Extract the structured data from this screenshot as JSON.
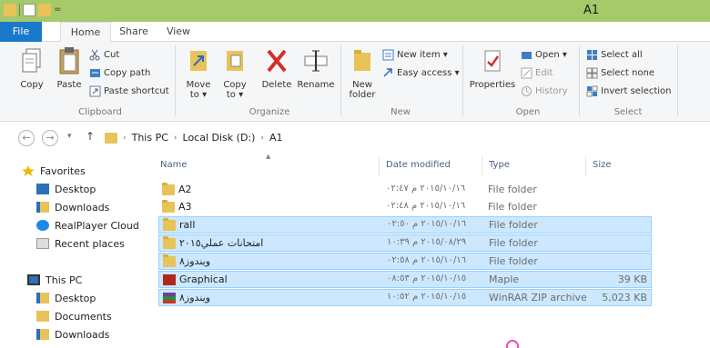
{
  "window": {
    "title": "A1"
  },
  "quick_access": {
    "arrow": "="
  },
  "tabs": {
    "file": "File",
    "home": "Home",
    "share": "Share",
    "view": "View"
  },
  "ribbon": {
    "clipboard": {
      "copy": "Copy",
      "paste": "Paste",
      "cut": "Cut",
      "copy_path": "Copy path",
      "paste_shortcut": "Paste shortcut",
      "group_label": "Clipboard"
    },
    "organize": {
      "move_to": "Move to ▾",
      "copy_to": "Copy to ▾",
      "delete": "Delete",
      "rename": "Rename",
      "group_label": "Organize"
    },
    "new": {
      "new_folder": "New folder",
      "new_item": "New item ▾",
      "easy_access": "Easy access ▾",
      "group_label": "New"
    },
    "open": {
      "properties": "Properties",
      "open": "Open ▾",
      "edit": "Edit",
      "history": "History",
      "group_label": "Open"
    },
    "select": {
      "select_all": "Select all",
      "select_none": "Select none",
      "invert_selection": "Invert selection",
      "group_label": "Select"
    }
  },
  "address": {
    "back": "←",
    "forward": "→",
    "recent": "▾",
    "up": "↑",
    "crumbs": [
      "This PC",
      "Local Disk (D:)",
      "A1"
    ],
    "separator": "›"
  },
  "navpane": {
    "favorites": "Favorites",
    "desktop": "Desktop",
    "downloads": "Downloads",
    "realplayer": "RealPlayer Cloud",
    "recent_places": "Recent places",
    "this_pc": "This PC",
    "pc_desktop": "Desktop",
    "documents": "Documents",
    "pc_downloads": "Downloads"
  },
  "columns": {
    "name": "Name",
    "date": "Date modified",
    "type": "Type",
    "size": "Size"
  },
  "files": [
    {
      "name": "A2",
      "date": "٢٠١٥/١٠/١٦ م ٠٢:٤٧",
      "type": "File folder",
      "size": "",
      "icon": "folder",
      "selected": false
    },
    {
      "name": "A3",
      "date": "٢٠١٥/١٠/١٦ م ٠٢:٤٨",
      "type": "File folder",
      "size": "",
      "icon": "folder",
      "selected": false
    },
    {
      "name": "rall",
      "date": "٢٠١٥/١٠/١٦ م ٠٢:٥٠",
      "type": "File folder",
      "size": "",
      "icon": "folder",
      "selected": true
    },
    {
      "name": "امتحانات عملي٢٠١٥",
      "date": "٢٠١٥/٠٨/٢٩ م ١٠:٣٩",
      "type": "File folder",
      "size": "",
      "icon": "folder",
      "selected": true
    },
    {
      "name": "ويندوز٨",
      "date": "٢٠١٥/١٠/١٦ م ٠٢:٥٨",
      "type": "File folder",
      "size": "",
      "icon": "folder",
      "selected": true
    },
    {
      "name": "Graphical",
      "date": "٢٠١٥/١٠/١٥ م ٠٨:٥٣",
      "type": "Maple",
      "size": "39 KB",
      "icon": "maple",
      "selected": true
    },
    {
      "name": "ويندوز٨",
      "date": "٢٠١٥/١٠/١٥ م ١٠:٥٢",
      "type": "WinRAR ZIP archive",
      "size": "5,023 KB",
      "icon": "rar",
      "selected": true
    }
  ],
  "colors": {
    "titlebar": "#a6c96a",
    "file_tab": "#1979ca",
    "selection_bg": "#cce8ff",
    "selection_border": "#99d1ff",
    "folder": "#e8c35a"
  }
}
